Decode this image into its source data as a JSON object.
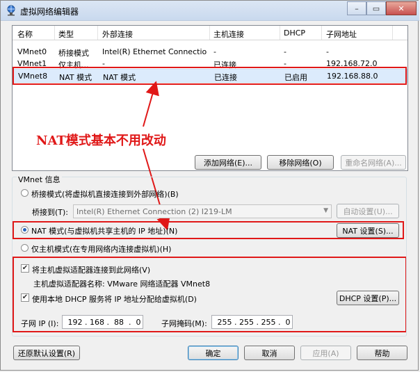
{
  "window": {
    "title": "虚拟网络编辑器"
  },
  "titlebar_buttons": {
    "minimize": "–",
    "maximize": "▭",
    "close": "✕"
  },
  "table": {
    "headers": [
      "名称",
      "类型",
      "外部连接",
      "主机连接",
      "DHCP",
      "子网地址"
    ],
    "rows": [
      [
        "VMnet0",
        "桥接模式",
        "Intel(R) Ethernet Connectio...",
        "-",
        "-",
        "-"
      ],
      [
        "VMnet1",
        "仅主机...",
        "-",
        "已连接",
        "-",
        "192.168.72.0"
      ],
      [
        "VMnet8",
        "NAT 模式",
        "NAT 模式",
        "已连接",
        "已启用",
        "192.168.88.0"
      ]
    ]
  },
  "annotation": "NAT模式基本不用改动",
  "table_buttons": {
    "add": "添加网络(E)...",
    "remove": "移除网络(O)",
    "rename": "重命名网络(A)..."
  },
  "vmnet_info": {
    "group_label": "VMnet 信息",
    "bridge_mode": "桥接模式(将虚拟机直接连接到外部网络)(B)",
    "bridge_to_label": "桥接到(T):",
    "bridge_to_value": "Intel(R) Ethernet Connection (2) I219-LM",
    "auto_settings": "自动设置(U)...",
    "nat_mode": "NAT 模式(与虚拟机共享主机的 IP 地址)(N)",
    "nat_settings": "NAT 设置(S)...",
    "host_only": "仅主机模式(在专用网络内连接虚拟机)(H)",
    "connect_adapter": "将主机虚拟适配器连接到此网络(V)",
    "adapter_name": "主机虚拟适配器名称: VMware 网络适配器 VMnet8",
    "use_dhcp": "使用本地 DHCP 服务将 IP 地址分配给虚拟机(D)",
    "dhcp_settings": "DHCP 设置(P)...",
    "subnet_ip_label": "子网 IP (I):",
    "subnet_ip_value": " 192 . 168 .  88  .  0",
    "subnet_mask_label": "子网掩码(M):",
    "subnet_mask_value": " 255 . 255 . 255 .  0"
  },
  "footer": {
    "restore": "还原默认设置(R)",
    "ok": "确定",
    "cancel": "取消",
    "apply": "应用(A)",
    "help": "帮助"
  },
  "colors": {
    "annotation_red": "#e01818",
    "selection_blue": "#dcebfc"
  }
}
